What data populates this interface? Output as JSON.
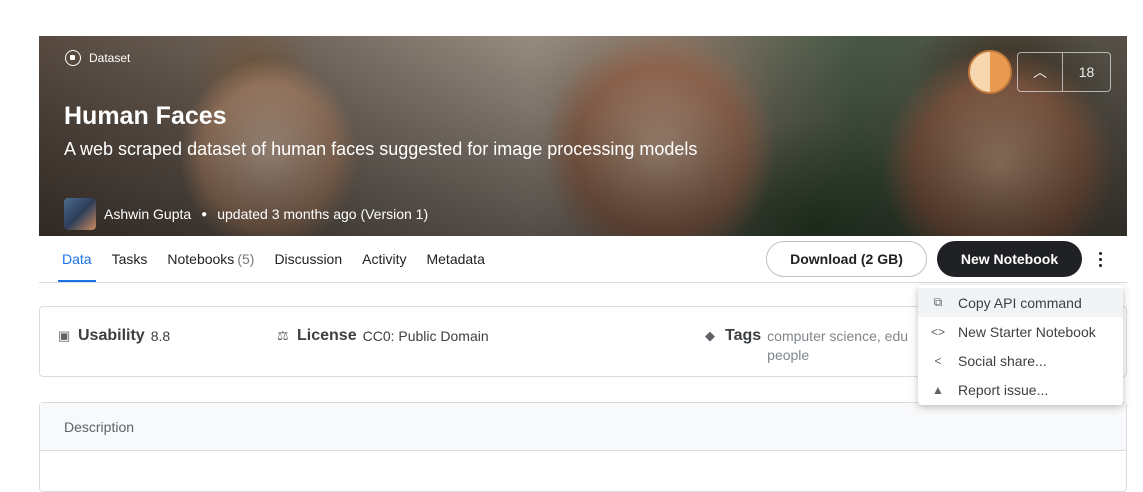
{
  "banner": {
    "type_label": "Dataset",
    "title": "Human Faces",
    "subtitle": "A web scraped dataset of human faces suggested for image processing models",
    "author": "Ashwin Gupta",
    "updated": "updated 3 months ago (Version 1)",
    "vote_count": "18"
  },
  "tabs": [
    {
      "label": "Data",
      "active": true
    },
    {
      "label": "Tasks"
    },
    {
      "label": "Notebooks",
      "count": "(5)"
    },
    {
      "label": "Discussion"
    },
    {
      "label": "Activity"
    },
    {
      "label": "Metadata"
    }
  ],
  "actions": {
    "download_label": "Download (2 GB)",
    "new_notebook_label": "New Notebook"
  },
  "info": {
    "usability_label": "Usability",
    "usability_value": "8.8",
    "license_label": "License",
    "license_value": "CC0: Public Domain",
    "tags_label": "Tags",
    "tags_value": "computer science, edu people"
  },
  "description": {
    "header": "Description"
  },
  "menu": {
    "items": [
      {
        "label": "Copy API command",
        "icon": "copy-icon"
      },
      {
        "label": "New Starter Notebook",
        "icon": "code-icon"
      },
      {
        "label": "Social share...",
        "icon": "share-icon"
      },
      {
        "label": "Report issue...",
        "icon": "warning-icon"
      }
    ]
  },
  "colors": {
    "accent": "#1a73e8",
    "primary_button": "#202124"
  }
}
